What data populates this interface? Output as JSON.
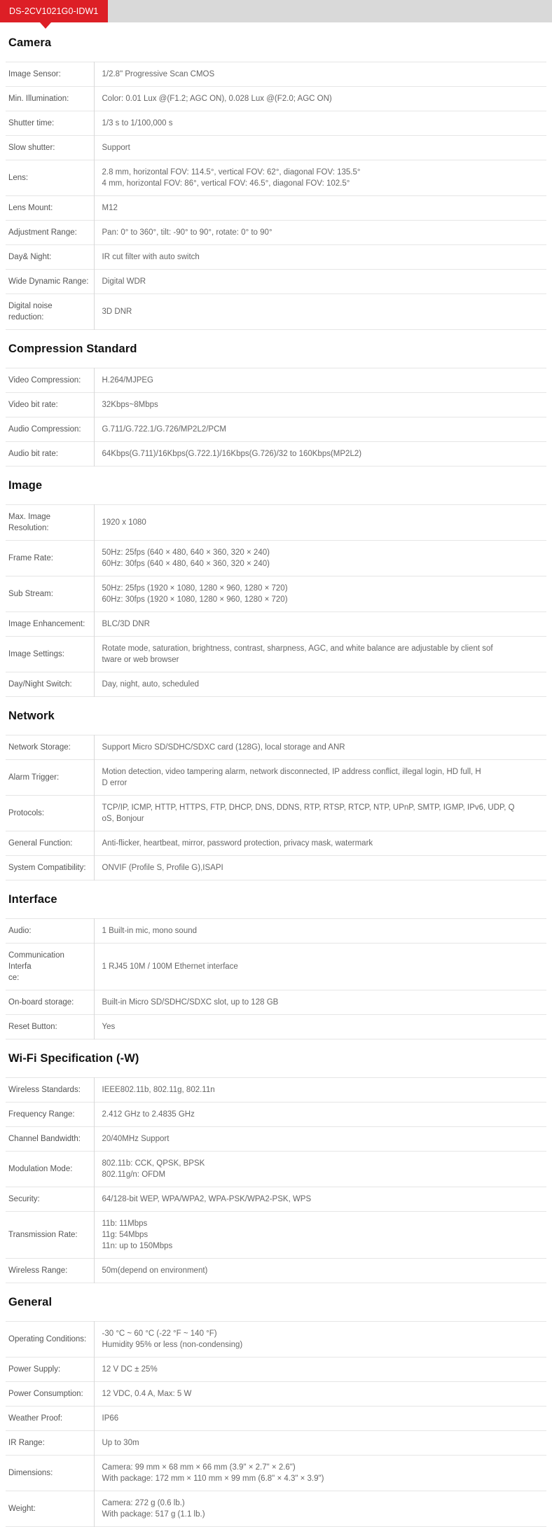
{
  "tab": {
    "label": "DS-2CV1021G0-IDW1"
  },
  "colors": {
    "accent": "#dd1f26",
    "tabbar_bg": "#d9d9d9",
    "rule": "#e6e6e6",
    "text": "#555555"
  },
  "sections": [
    {
      "title": "Camera",
      "rows": [
        {
          "label": "Image Sensor:",
          "lines": [
            "1/2.8\" Progressive Scan CMOS"
          ]
        },
        {
          "label": "Min. Illumination:",
          "lines": [
            "Color: 0.01 Lux @(F1.2; AGC ON), 0.028 Lux @(F2.0; AGC ON)"
          ]
        },
        {
          "label": "Shutter time:",
          "lines": [
            "1/3 s to 1/100,000 s"
          ]
        },
        {
          "label": "Slow shutter:",
          "lines": [
            "Support"
          ]
        },
        {
          "label": "Lens:",
          "lines": [
            "2.8 mm, horizontal FOV: 114.5°, vertical FOV: 62°, diagonal FOV: 135.5°",
            "4 mm, horizontal FOV: 86°, vertical FOV: 46.5°, diagonal FOV: 102.5°"
          ]
        },
        {
          "label": "Lens Mount:",
          "lines": [
            "M12"
          ]
        },
        {
          "label": "Adjustment Range:",
          "lines": [
            "Pan: 0° to 360°, tilt: -90° to 90°, rotate: 0° to 90°"
          ]
        },
        {
          "label": "Day& Night:",
          "lines": [
            "IR cut filter with auto switch"
          ]
        },
        {
          "label": "Wide Dynamic Range:",
          "lines": [
            "Digital WDR"
          ]
        },
        {
          "label": "Digital noise reduction:",
          "lines": [
            "3D DNR"
          ]
        }
      ]
    },
    {
      "title": "Compression Standard",
      "rows": [
        {
          "label": "Video Compression:",
          "lines": [
            "H.264/MJPEG"
          ]
        },
        {
          "label": "Video bit rate:",
          "lines": [
            "32Kbps~8Mbps"
          ]
        },
        {
          "label": "Audio Compression:",
          "lines": [
            "G.711/G.722.1/G.726/MP2L2/PCM"
          ]
        },
        {
          "label": "Audio bit rate:",
          "lines": [
            "64Kbps(G.711)/16Kbps(G.722.1)/16Kbps(G.726)/32 to 160Kbps(MP2L2)"
          ]
        }
      ]
    },
    {
      "title": "Image",
      "rows": [
        {
          "label": "Max. Image Resolution:",
          "lines": [
            "1920 x 1080"
          ]
        },
        {
          "label": "Frame Rate:",
          "lines": [
            "50Hz: 25fps (640 × 480, 640 × 360, 320 × 240)",
            "60Hz: 30fps (640 × 480, 640 × 360, 320 × 240)"
          ]
        },
        {
          "label": "Sub Stream:",
          "lines": [
            "50Hz: 25fps (1920 × 1080, 1280 × 960, 1280 × 720)",
            "60Hz: 30fps (1920 × 1080, 1280 × 960, 1280 × 720)"
          ]
        },
        {
          "label": "Image Enhancement:",
          "lines": [
            "BLC/3D DNR"
          ]
        },
        {
          "label": "Image Settings:",
          "lines": [
            "Rotate mode, saturation, brightness, contrast, sharpness, AGC, and white balance are adjustable by client sof",
            "tware or web browser"
          ]
        },
        {
          "label": "Day/Night Switch:",
          "lines": [
            "Day, night, auto, scheduled"
          ]
        }
      ]
    },
    {
      "title": "Network",
      "rows": [
        {
          "label": "Network Storage:",
          "lines": [
            "Support Micro SD/SDHC/SDXC card (128G), local storage and ANR"
          ]
        },
        {
          "label": "Alarm Trigger:",
          "lines": [
            "Motion detection, video tampering alarm, network disconnected, IP address conflict, illegal login, HD full, H",
            "D error"
          ]
        },
        {
          "label": "Protocols:",
          "lines": [
            "TCP/IP, ICMP, HTTP, HTTPS, FTP, DHCP, DNS, DDNS, RTP, RTSP, RTCP, NTP, UPnP, SMTP, IGMP, IPv6, UDP, Q",
            "oS, Bonjour"
          ]
        },
        {
          "label": "General Function:",
          "lines": [
            "Anti-flicker, heartbeat, mirror, password protection, privacy mask, watermark"
          ]
        },
        {
          "label": "System Compatibility:",
          "lines": [
            "ONVIF (Profile S, Profile G),ISAPI"
          ]
        }
      ]
    },
    {
      "title": "Interface",
      "rows": [
        {
          "label": "Audio:",
          "lines": [
            "1 Built-in mic, mono sound"
          ]
        },
        {
          "label": "Communication Interfa\nce:",
          "lines": [
            "1 RJ45 10M / 100M Ethernet interface"
          ]
        },
        {
          "label": "On-board storage:",
          "lines": [
            "Built-in Micro SD/SDHC/SDXC slot, up to 128 GB"
          ]
        },
        {
          "label": "Reset Button:",
          "lines": [
            "Yes"
          ]
        }
      ]
    },
    {
      "title": "Wi-Fi Specification (-W)",
      "rows": [
        {
          "label": "Wireless Standards:",
          "lines": [
            "IEEE802.11b, 802.11g, 802.11n"
          ]
        },
        {
          "label": "Frequency Range:",
          "lines": [
            "2.412 GHz to 2.4835 GHz"
          ]
        },
        {
          "label": "Channel Bandwidth:",
          "lines": [
            "20/40MHz Support"
          ]
        },
        {
          "label": "Modulation Mode:",
          "lines": [
            "802.11b: CCK, QPSK, BPSK",
            "802.11g/n: OFDM"
          ]
        },
        {
          "label": "Security:",
          "lines": [
            "64/128-bit WEP, WPA/WPA2, WPA-PSK/WPA2-PSK, WPS"
          ]
        },
        {
          "label": "Transmission Rate:",
          "lines": [
            "11b: 11Mbps",
            "11g: 54Mbps",
            "11n: up to 150Mbps"
          ]
        },
        {
          "label": "Wireless Range:",
          "lines": [
            "50m(depend on environment)"
          ]
        }
      ]
    },
    {
      "title": "General",
      "rows": [
        {
          "label": "Operating Conditions:",
          "lines": [
            "-30 °C ~ 60 °C (-22 °F ~ 140 °F)",
            "Humidity 95% or less (non-condensing)"
          ]
        },
        {
          "label": "Power Supply:",
          "lines": [
            "12 V DC ± 25%"
          ]
        },
        {
          "label": "Power Consumption:",
          "lines": [
            "12 VDC, 0.4 A, Max: 5 W"
          ]
        },
        {
          "label": "Weather Proof:",
          "lines": [
            "IP66"
          ]
        },
        {
          "label": "IR Range:",
          "lines": [
            "Up to 30m"
          ]
        },
        {
          "label": "Dimensions:",
          "lines": [
            "Camera: 99 mm × 68 mm × 66 mm (3.9\" × 2.7\" × 2.6\")",
            "With package: 172 mm × 110 mm × 99 mm (6.8\" × 4.3\" × 3.9\")"
          ]
        },
        {
          "label": "Weight:",
          "lines": [
            "Camera: 272 g (0.6 lb.)",
            "With package: 517 g (1.1 lb.)"
          ]
        }
      ]
    }
  ]
}
